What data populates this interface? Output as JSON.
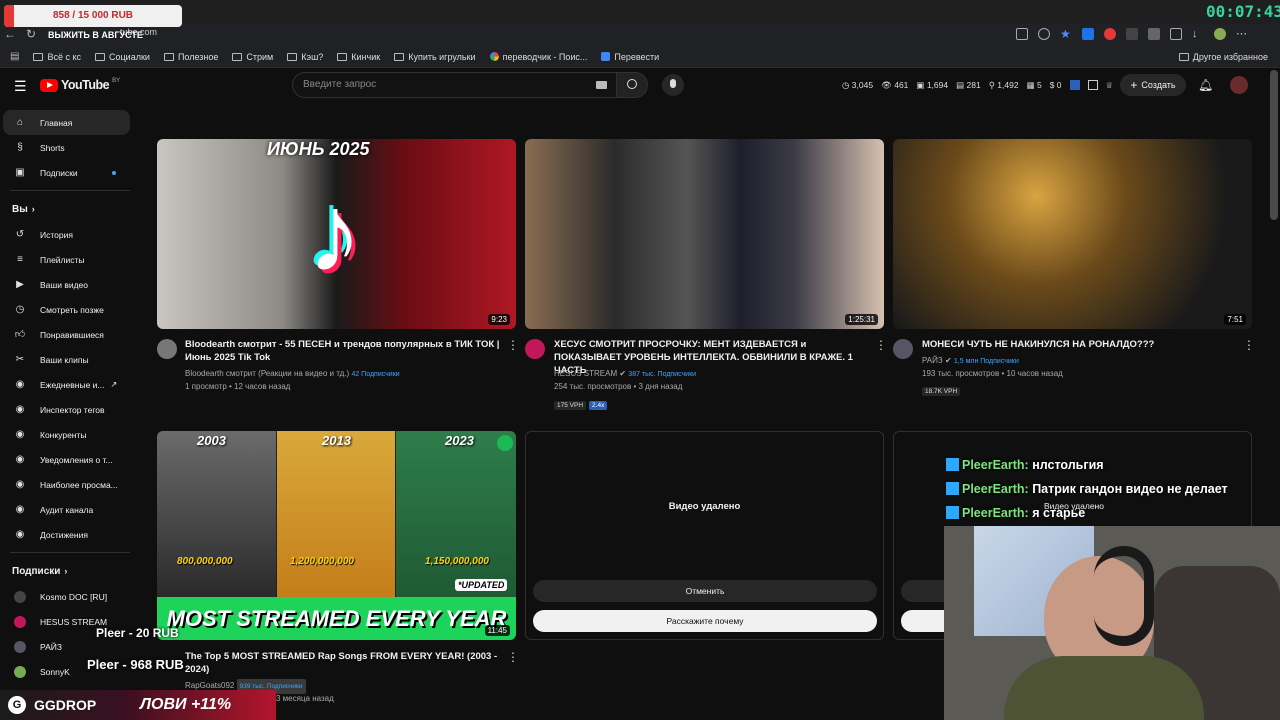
{
  "overlay": {
    "donation_goal": "858 / 15 000 RUB",
    "donation_progress": 0.057,
    "donation_caption": "ВЫЖИТЬ В АВГУСТЕ",
    "timer": "00:07:43",
    "tips": [
      "Pleer - 20 RUB",
      "Pleer - 968 RUB"
    ],
    "ggdrop_brand": "GGDROP",
    "ggdrop_promo": "ЛОВИ +11%"
  },
  "browser": {
    "url": "tube.com",
    "bookmarks": [
      "Всё с кс",
      "Социалки",
      "Полезное",
      "Стрим",
      "Кэш?",
      "Кинчик",
      "Купить игрульки",
      "переводчик - Поис...",
      "Перевести"
    ],
    "bookmarks_right": "Другое избранное"
  },
  "header": {
    "logo_text": "YouTube",
    "logo_suffix": "BY",
    "search_placeholder": "Введите запрос",
    "stats": [
      "3,045",
      "461",
      "1,694",
      "281",
      "1,492",
      "5",
      "0"
    ],
    "create_label": "Создать"
  },
  "sidebar": {
    "main": [
      {
        "label": "Главная",
        "icon": "home-icon",
        "active": true
      },
      {
        "label": "Shorts",
        "icon": "shorts-icon"
      },
      {
        "label": "Подписки",
        "icon": "subscriptions-icon"
      }
    ],
    "you_title": "Вы",
    "you": [
      {
        "label": "История",
        "icon": "history-icon"
      },
      {
        "label": "Плейлисты",
        "icon": "playlists-icon"
      },
      {
        "label": "Ваши видео",
        "icon": "your-videos-icon"
      },
      {
        "label": "Смотреть позже",
        "icon": "watch-later-icon"
      },
      {
        "label": "Понравившиеся",
        "icon": "like-icon"
      },
      {
        "label": "Ваши клипы",
        "icon": "clips-icon"
      },
      {
        "label": "Ежедневные и...",
        "icon": "extension-icon"
      },
      {
        "label": "Инспектор тегов",
        "icon": "extension-icon"
      },
      {
        "label": "Конкуренты",
        "icon": "extension-icon"
      },
      {
        "label": "Уведомления о т...",
        "icon": "extension-icon"
      },
      {
        "label": "Наиболее просма...",
        "icon": "extension-icon"
      },
      {
        "label": "Аудит канала",
        "icon": "extension-icon"
      },
      {
        "label": "Достижения",
        "icon": "extension-icon"
      }
    ],
    "subs_title": "Подписки",
    "subs": [
      "Kosmo DOC [RU]",
      "HESUS STREAM",
      "РАЙЗ",
      "SonnyK"
    ]
  },
  "videos": [
    {
      "thumb_text": "ИЮНЬ 2025",
      "duration": "9:23",
      "title": "Bloodearth смотрит - 55 ПЕСЕН и трендов популярных в ТИК ТОК | Июнь 2025 Tik Tok",
      "channel": "Bloodearth смотрит (Реакции на видео и тд.)",
      "subs": "42 Подписчики",
      "meta": "1 просмотр • 12 часов назад"
    },
    {
      "duration": "1:25:31",
      "title": "ХЕСУС СМОТРИТ ПРОСРОЧКУ: МЕНТ ИЗДЕВАЕТСЯ и ПОКАЗЫВАЕТ УРОВЕНЬ ИНТЕЛЛЕКТА. ОБВИНИЛИ В КРАЖЕ. 1 ЧАСТЬ",
      "channel": "HESUS STREAM",
      "subs": "387 тыс. Подписчики",
      "meta": "254 тыс. просмотров • 3 дня назад",
      "tags": [
        "175 VPH",
        "2.4x"
      ]
    },
    {
      "duration": "7:51",
      "title": "МОНЕСИ ЧУТЬ НЕ НАКИНУЛСЯ НА РОНАЛДО???",
      "channel": "РАЙЗ",
      "subs": "1,5 млн Подписчики",
      "meta": "193 тыс. просмотров • 10 часов назад",
      "tags": [
        "18.7K VPH"
      ]
    },
    {
      "thumb_years": [
        "2003",
        "2013",
        "2023"
      ],
      "thumb_counts": [
        "800,000,000",
        "1,200,000,000",
        "1,150,000,000"
      ],
      "thumb_badge": "*UPDATED",
      "thumb_banner": "MOST STREAMED EVERY YEAR",
      "duration": "11:45",
      "title": "The Top 5 MOST STREAMED Rap Songs FROM EVERY YEAR! (2003 - 2024)",
      "channel": "RapGoats092",
      "subs": "939 тыс. Подписчики",
      "meta": "3 месяца назад"
    }
  ],
  "deleted_card": {
    "text": "Видео удалено",
    "cancel": "Отменить",
    "why": "Расскажите почему"
  },
  "chat": [
    {
      "nick": "PleerEarth:",
      "msg": "нлстольгия"
    },
    {
      "nick": "PleerEarth:",
      "msg": "Патрик гандон видео не делает"
    },
    {
      "nick": "PleerEarth:",
      "msg": "я старье"
    }
  ],
  "colors": {
    "accent_red": "#ff0000",
    "link_blue": "#3ea6ff",
    "chat_nick": "#7de37d",
    "timer": "#35d3a3"
  }
}
